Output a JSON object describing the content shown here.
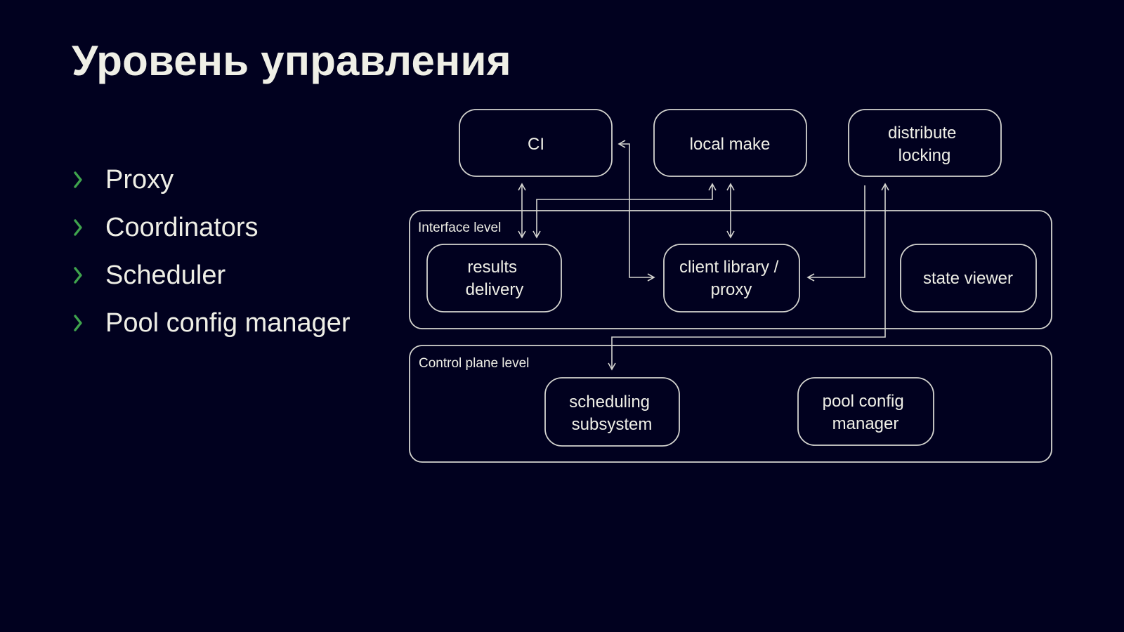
{
  "slide": {
    "title": "Уровень управления",
    "background_color": "#01011f",
    "text_color": "#efefe6",
    "accent_color": "#3fa34d"
  },
  "bullets": {
    "icon": "chevron-right-icon",
    "items": [
      {
        "label": "Proxy"
      },
      {
        "label": "Coordinators"
      },
      {
        "label": "Scheduler"
      },
      {
        "label": "Pool config manager"
      }
    ]
  },
  "diagram": {
    "groups": {
      "interface": {
        "label": "Interface level"
      },
      "control_plane": {
        "label": "Control plane level"
      }
    },
    "nodes": {
      "ci": {
        "lines": [
          "CI"
        ]
      },
      "local_make": {
        "lines": [
          "local make"
        ]
      },
      "distribute_locking": {
        "lines": [
          "distribute",
          "locking"
        ]
      },
      "results_delivery": {
        "lines": [
          "results",
          "delivery"
        ]
      },
      "client_library_proxy": {
        "lines": [
          "client library /",
          "proxy"
        ]
      },
      "state_viewer": {
        "lines": [
          "state viewer"
        ]
      },
      "scheduling_subsystem": {
        "lines": [
          "scheduling",
          "subsystem"
        ]
      },
      "pool_config_manager": {
        "lines": [
          "pool config",
          "manager"
        ]
      }
    },
    "edges": [
      {
        "from": "ci",
        "to": "results_delivery",
        "direction": "bidirectional"
      },
      {
        "from": "local_make",
        "to": "results_delivery",
        "direction": "bidirectional"
      },
      {
        "from": "local_make",
        "to": "client_library_proxy",
        "direction": "bidirectional"
      },
      {
        "from": "client_library_proxy",
        "to": "ci",
        "direction": "bidirectional"
      },
      {
        "from": "distribute_locking",
        "to": "client_library_proxy",
        "direction": "forward"
      },
      {
        "from": "scheduling_subsystem",
        "to": "distribute_locking",
        "direction": "bidirectional"
      }
    ]
  }
}
